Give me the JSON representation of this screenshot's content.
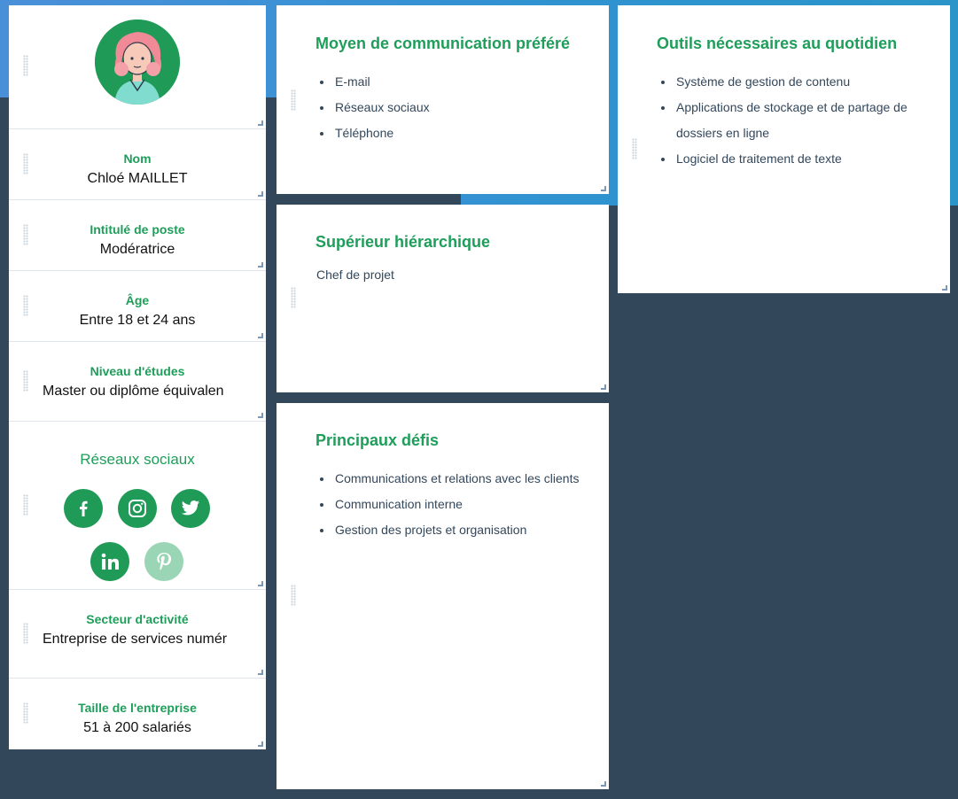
{
  "profile": {
    "name_label": "Nom",
    "name_value": "Chloé MAILLET",
    "job_label": "Intitulé de poste",
    "job_value": "Modératrice",
    "age_label": "Âge",
    "age_value": "Entre 18 et 24 ans",
    "education_label": "Niveau d'études",
    "education_value": "Master ou diplôme équivalen",
    "social_label": "Réseaux sociaux",
    "social_icons": [
      "facebook-icon",
      "instagram-icon",
      "twitter-icon",
      "linkedin-icon",
      "pinterest-icon"
    ],
    "industry_label": "Secteur d'activité",
    "industry_value": "Entreprise de services numér",
    "company_size_label": "Taille de l'entreprise",
    "company_size_value": "51 à 200 salariés"
  },
  "communication": {
    "title": "Moyen de communication préféré",
    "items": [
      "E-mail",
      "Réseaux sociaux",
      "Téléphone"
    ]
  },
  "manager": {
    "title": "Supérieur hiérarchique",
    "value": "Chef de projet"
  },
  "challenges": {
    "title": "Principaux défis",
    "items": [
      "Communications et relations avec les clients",
      "Communication interne",
      "Gestion des projets et organisation"
    ]
  },
  "tools": {
    "title": "Outils nécessaires au quotidien",
    "items": [
      "Système de gestion de contenu",
      "Applications de stockage et de partage de dossiers en ligne",
      "Logiciel de traitement de texte"
    ]
  },
  "colors": {
    "accent": "#1e9e5a",
    "background": "#33475b",
    "header_band": "#2f93d0"
  }
}
